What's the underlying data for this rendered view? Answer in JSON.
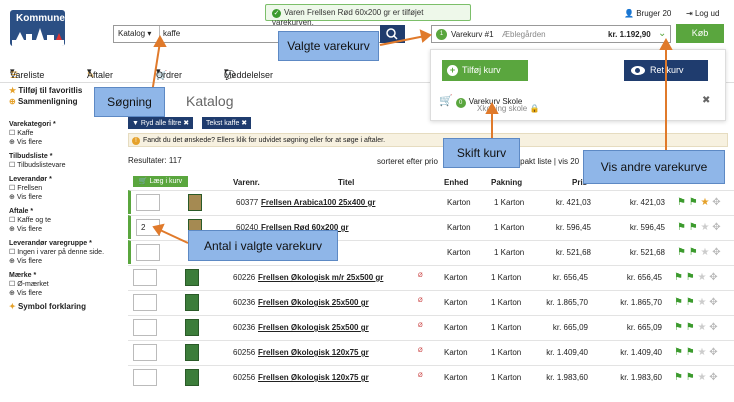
{
  "brand": {
    "logo_text": "Kommune",
    "brand_color": "#2b4f84"
  },
  "notification": {
    "text": "Varen Frellsen Rød 60x200 gr er tilføjet varekurven."
  },
  "header": {
    "user_label": "Bruger 20",
    "logout_label": "Log ud"
  },
  "search": {
    "category": "Katalog",
    "query": "kaffe"
  },
  "basket": {
    "count": "1",
    "name": "Varekurv #1",
    "location": "Æblegården",
    "total": "kr. 1.192,90",
    "buy_label": "Køb"
  },
  "nav": {
    "items": [
      "Vareliste",
      "Aftaler",
      "Ordrer",
      "Meddelelser"
    ]
  },
  "sidebar": {
    "favorites": "Tilføj til favoritlis",
    "compare": "Sammenligning",
    "groups": [
      {
        "title": "Varekategori *",
        "opts": [
          "Kaffe",
          "Vis flere"
        ]
      },
      {
        "title": "Tilbudsliste *",
        "opts": [
          "Tilbudslistevare"
        ]
      },
      {
        "title": "Leverandør *",
        "opts": [
          "Frellsen",
          "Vis flere"
        ]
      },
      {
        "title": "Aftale *",
        "opts": [
          "Kaffe og te",
          "Vis flere"
        ]
      },
      {
        "title": "Leverandør varegruppe *",
        "opts": [
          "Ingen i varer på denne side.",
          "Vis flere"
        ]
      },
      {
        "title": "Mærke *",
        "opts": [
          "Ø-mærket",
          "Vis flere"
        ]
      }
    ],
    "symbols": "Symbol forklaring"
  },
  "main": {
    "title": "Katalog",
    "filter_clear": "Ryd alle filtre",
    "filter_text": "Tekst kaffe",
    "warning": "Fandt du det ønskede? Ellers klik for udvidet søgning eller for at søge i aftaler.",
    "results": "Resultater: 117",
    "sort": "sorteret efter prio",
    "compact": "kompakt liste | vis 20",
    "add_basket": "Læg i kurv",
    "columns": [
      "Varenr.",
      "Titel",
      "Enhed",
      "Pakning",
      "Pris"
    ]
  },
  "rows": [
    {
      "qty": "",
      "no": "60377",
      "name": "Frellsen Arabica100 25x400 gr",
      "eco": "",
      "unit": "Karton",
      "pack": "1 Karton",
      "p1": "kr. 421,03",
      "p2": "kr. 421,03"
    },
    {
      "qty": "2",
      "no": "60240",
      "name": "Frellsen Rød 60x200 gr",
      "eco": "",
      "unit": "Karton",
      "pack": "1 Karton",
      "p1": "kr. 596,45",
      "p2": "kr. 596,45"
    },
    {
      "qty": "",
      "no": "",
      "name": "",
      "eco": "",
      "unit": "Karton",
      "pack": "1 Karton",
      "p1": "kr. 521,68",
      "p2": "kr. 521,68"
    },
    {
      "qty": "",
      "no": "60226",
      "name": "Frellsen Økologisk m/r 25x500 gr",
      "eco": "Ø",
      "unit": "Karton",
      "pack": "1 Karton",
      "p1": "kr. 656,45",
      "p2": "kr. 656,45"
    },
    {
      "qty": "",
      "no": "60236",
      "name": "Frellsen Økologisk 25x500 gr",
      "eco": "Ø",
      "unit": "Karton",
      "pack": "1 Karton",
      "p1": "kr. 1.865,70",
      "p2": "kr. 1.865,70"
    },
    {
      "qty": "",
      "no": "60236",
      "name": "Frellsen Økologisk 25x500 gr",
      "eco": "Ø",
      "unit": "Karton",
      "pack": "1 Karton",
      "p1": "kr. 665,09",
      "p2": "kr. 665,09"
    },
    {
      "qty": "",
      "no": "60256",
      "name": "Frellsen Økologisk 120x75 gr",
      "eco": "Ø",
      "unit": "Karton",
      "pack": "1 Karton",
      "p1": "kr. 1.409,40",
      "p2": "kr. 1.409,40"
    },
    {
      "qty": "",
      "no": "60256",
      "name": "Frellsen Økologisk 120x75 gr",
      "eco": "Ø",
      "unit": "Karton",
      "pack": "1 Karton",
      "p1": "kr. 1.983,60",
      "p2": "kr. 1.983,60"
    }
  ],
  "dropdown": {
    "add_label": "Tilføj kurv",
    "ret_label": "Ret kurv",
    "basket_name": "Varekurv Skole",
    "basket_sub": "Xkøbing skole",
    "basket_count": "0"
  },
  "callouts": {
    "search": "Søgning",
    "basket": "Valgte varekurv",
    "switch": "Skift kurv",
    "others": "Vis andre varekurve",
    "qty": "Antal i valgte varekurv"
  }
}
